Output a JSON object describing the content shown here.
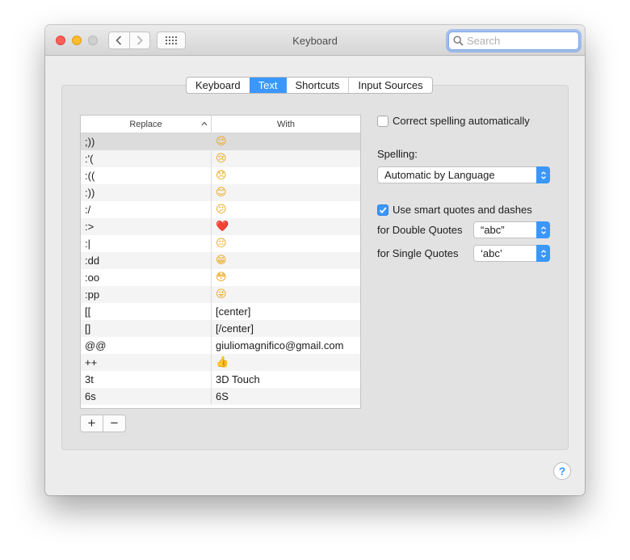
{
  "window": {
    "title": "Keyboard",
    "search_placeholder": "Search"
  },
  "tabs": [
    {
      "label": "Keyboard",
      "active": false
    },
    {
      "label": "Text",
      "active": true
    },
    {
      "label": "Shortcuts",
      "active": false
    },
    {
      "label": "Input Sources",
      "active": false
    }
  ],
  "table": {
    "columns": {
      "replace": "Replace",
      "with": "With"
    },
    "rows": [
      {
        "replace": ";))",
        "with": "😉",
        "icon": "wink-emoji"
      },
      {
        "replace": ":'(",
        "with": "😢",
        "icon": "crying-emoji"
      },
      {
        "replace": ":((",
        "with": "😞",
        "icon": "disappointed-emoji"
      },
      {
        "replace": ":))",
        "with": "😊",
        "icon": "smile-emoji"
      },
      {
        "replace": ":/",
        "with": "😕",
        "icon": "confused-emoji"
      },
      {
        "replace": ":>",
        "with": "❤️",
        "icon": "heart-emoji"
      },
      {
        "replace": ":|",
        "with": "😐",
        "icon": "neutral-emoji"
      },
      {
        "replace": ":dd",
        "with": "😁",
        "icon": "grin-emoji"
      },
      {
        "replace": ":oo",
        "with": "😳",
        "icon": "flushed-emoji"
      },
      {
        "replace": ":pp",
        "with": "😜",
        "icon": "tongue-emoji"
      },
      {
        "replace": "[[",
        "with": "[center]"
      },
      {
        "replace": "[]",
        "with": "[/center]"
      },
      {
        "replace": "@@",
        "with": "giuliomagnifico@gmail.com"
      },
      {
        "replace": "++",
        "with": "👍",
        "icon": "thumbs-up-emoji"
      },
      {
        "replace": "3t",
        "with": "3D Touch"
      },
      {
        "replace": "6s",
        "with": "6S"
      }
    ]
  },
  "buttons": {
    "add": "+",
    "remove": "−"
  },
  "options": {
    "correct_spelling": {
      "label": "Correct spelling automatically",
      "checked": false
    },
    "spelling_label": "Spelling:",
    "spelling_value": "Automatic by Language",
    "smart_quotes": {
      "label": "Use smart quotes and dashes",
      "checked": true
    },
    "double_quotes_label": "for Double Quotes",
    "double_quotes_value": "“abc”",
    "single_quotes_label": "for Single Quotes",
    "single_quotes_value": "‘abc’"
  },
  "help": "?"
}
